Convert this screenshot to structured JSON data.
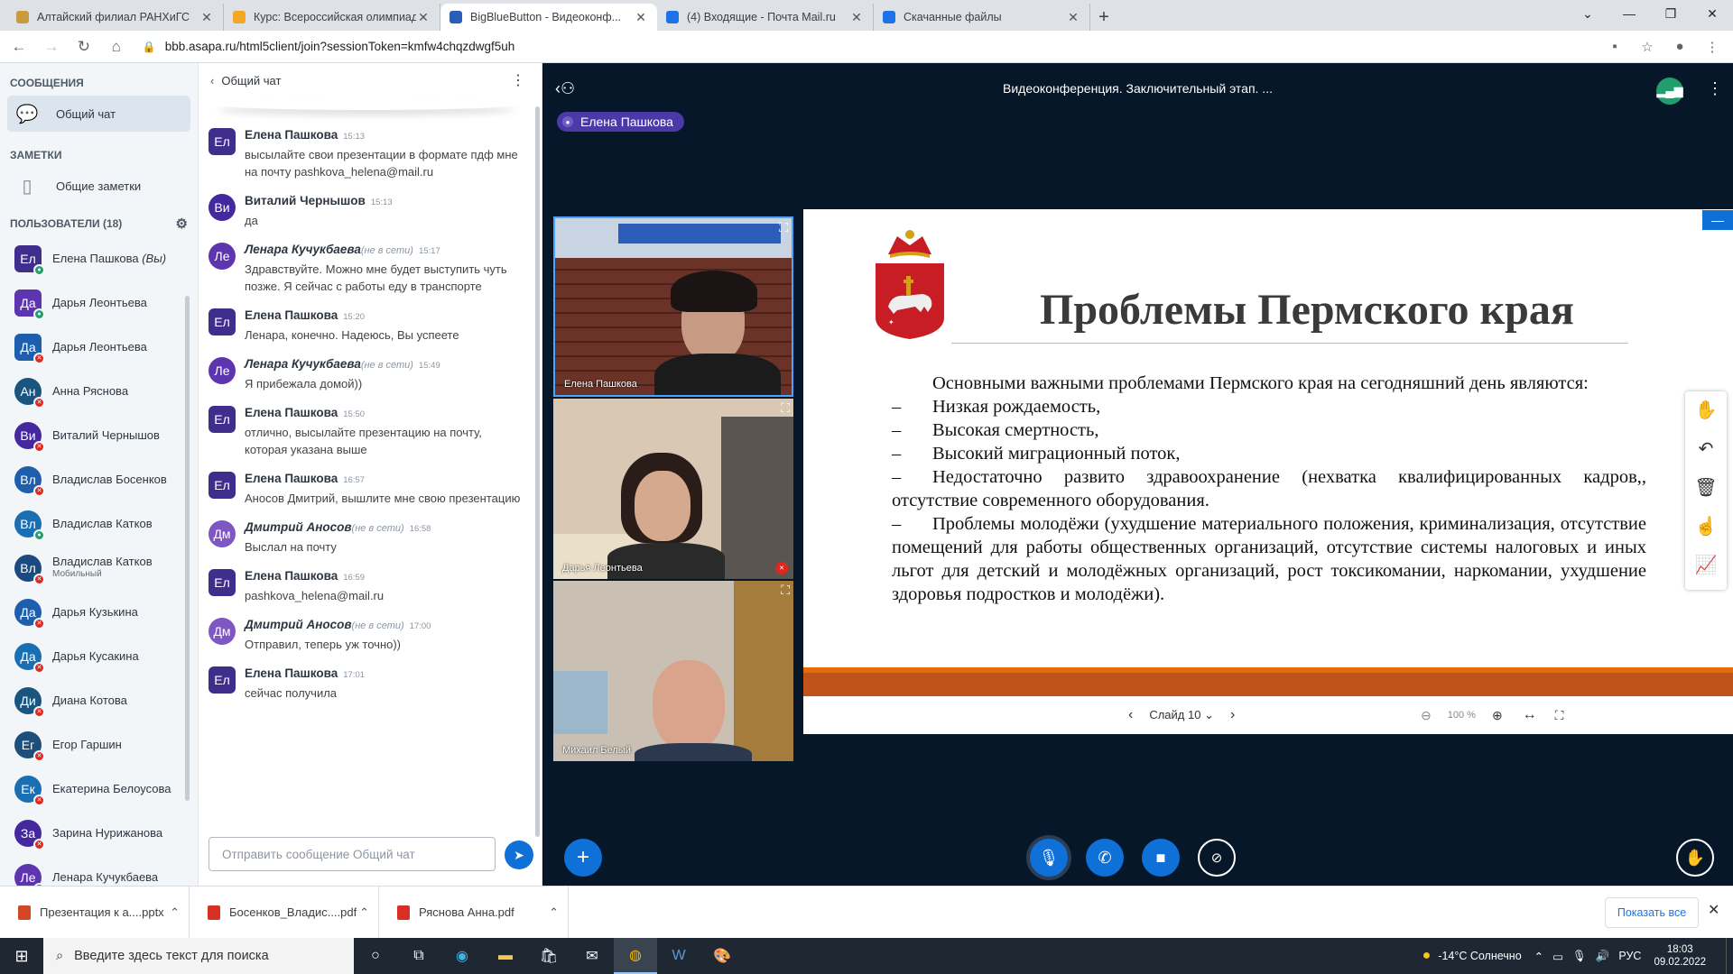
{
  "browser": {
    "tabs": [
      {
        "title": "Алтайский филиал РАНХиГС",
        "icon_color": "#c89b3c",
        "active": false
      },
      {
        "title": "Курс: Всероссийская олимпиад...",
        "icon_color": "#f5a623",
        "active": false
      },
      {
        "title": "BigBlueButton - Видеоконф...",
        "icon_color": "#2b5db7",
        "active": true
      },
      {
        "title": "(4) Входящие - Почта Mail.ru",
        "icon_color": "#1a73e8",
        "active": false
      },
      {
        "title": "Скачанные файлы",
        "icon_color": "#1a73e8",
        "active": false
      }
    ],
    "url": "bbb.asapa.ru/html5client/join?sessionToken=kmfw4chqzdwgf5uh"
  },
  "left": {
    "messages_header": "СООБЩЕНИЯ",
    "public_chat": "Общий чат",
    "notes_header": "ЗАМЕТКИ",
    "shared_notes": "Общие заметки",
    "users_header": "ПОЛЬЗОВАТЕЛИ (18)",
    "users": [
      {
        "initials": "Ел",
        "name": "Елена Пашкова",
        "suffix": "(Вы)",
        "color": "#3f2e8c",
        "shape": "square",
        "mic": "on",
        "sub": ""
      },
      {
        "initials": "Да",
        "name": "Дарья Леонтьева",
        "suffix": "",
        "color": "#5e35b1",
        "shape": "square",
        "mic": "on",
        "sub": ""
      },
      {
        "initials": "Да",
        "name": "Дарья Леонтьева",
        "suffix": "",
        "color": "#1e5fad",
        "shape": "square",
        "mic": "off",
        "sub": ""
      },
      {
        "initials": "Ан",
        "name": "Анна Ряснова",
        "suffix": "",
        "color": "#1a5580",
        "shape": "round",
        "mic": "off",
        "sub": ""
      },
      {
        "initials": "Ви",
        "name": "Виталий Чернышов",
        "suffix": "",
        "color": "#4527a0",
        "shape": "round",
        "mic": "off",
        "sub": ""
      },
      {
        "initials": "Вл",
        "name": "Владислав Босенков",
        "suffix": "",
        "color": "#1e5fad",
        "shape": "round",
        "mic": "off",
        "sub": ""
      },
      {
        "initials": "Вл",
        "name": "Владислав Катков",
        "suffix": "",
        "color": "#1a6fb3",
        "shape": "round",
        "mic": "on",
        "sub": ""
      },
      {
        "initials": "Вл",
        "name": "Владислав Катков",
        "suffix": "",
        "color": "#1a4a80",
        "shape": "round",
        "mic": "off",
        "sub": "Мобильный"
      },
      {
        "initials": "Да",
        "name": "Дарья Кузькина",
        "suffix": "",
        "color": "#1e5fad",
        "shape": "round",
        "mic": "off",
        "sub": ""
      },
      {
        "initials": "Да",
        "name": "Дарья Кусакина",
        "suffix": "",
        "color": "#1a6fb3",
        "shape": "round",
        "mic": "off",
        "sub": ""
      },
      {
        "initials": "Ди",
        "name": "Диана Котова",
        "suffix": "",
        "color": "#1a5580",
        "shape": "round",
        "mic": "off",
        "sub": ""
      },
      {
        "initials": "Ег",
        "name": "Егор Гаршин",
        "suffix": "",
        "color": "#1e4f7a",
        "shape": "round",
        "mic": "off",
        "sub": ""
      },
      {
        "initials": "Ек",
        "name": "Екатерина Белоусова",
        "suffix": "",
        "color": "#1a6fb3",
        "shape": "round",
        "mic": "off",
        "sub": ""
      },
      {
        "initials": "За",
        "name": "Зарина Нурижанова",
        "suffix": "",
        "color": "#4527a0",
        "shape": "round",
        "mic": "off",
        "sub": ""
      },
      {
        "initials": "Ле",
        "name": "Ленара Кучукбаева",
        "suffix": "",
        "color": "#5e35b1",
        "shape": "round",
        "mic": "off",
        "sub": ""
      }
    ]
  },
  "chat": {
    "title": "Общий чат",
    "offline_label": "(не в сети)",
    "messages": [
      {
        "initials": "Ел",
        "author": "Елена Пашкова",
        "time": "15:13",
        "offline": false,
        "color": "#3f2e8c",
        "shape": "square",
        "text": "высылайте свои презентации в формате пдф мне на почту pashkova_helena@mail.ru"
      },
      {
        "initials": "Ви",
        "author": "Виталий Чернышов",
        "time": "15:13",
        "offline": false,
        "color": "#4527a0",
        "shape": "round",
        "text": "да"
      },
      {
        "initials": "Ле",
        "author": "Ленара Кучукбаева",
        "time": "15:17",
        "offline": true,
        "color": "#5e35b1",
        "shape": "round",
        "text": "Здравствуйте. Можно мне будет выступить чуть позже. Я сейчас с работы еду в транспорте"
      },
      {
        "initials": "Ел",
        "author": "Елена Пашкова",
        "time": "15:20",
        "offline": false,
        "color": "#3f2e8c",
        "shape": "square",
        "text": "Ленара, конечно. Надеюсь, Вы успеете"
      },
      {
        "initials": "Ле",
        "author": "Ленара Кучукбаева",
        "time": "15:49",
        "offline": true,
        "color": "#5e35b1",
        "shape": "round",
        "text": "Я прибежала домой))"
      },
      {
        "initials": "Ел",
        "author": "Елена Пашкова",
        "time": "15:50",
        "offline": false,
        "color": "#3f2e8c",
        "shape": "square",
        "text": "отлично, высылайте презентацию на почту, которая указана выше"
      },
      {
        "initials": "Ел",
        "author": "Елена Пашкова",
        "time": "16:57",
        "offline": false,
        "color": "#3f2e8c",
        "shape": "square",
        "text": "Аносов Дмитрий, вышлите мне свою презентацию"
      },
      {
        "initials": "Дм",
        "author": "Дмитрий Аносов",
        "time": "16:58",
        "offline": true,
        "color": "#7e57c2",
        "shape": "round",
        "text": "Выслал на почту"
      },
      {
        "initials": "Ел",
        "author": "Елена Пашкова",
        "time": "16:59",
        "offline": false,
        "color": "#3f2e8c",
        "shape": "square",
        "text": "pashkova_helena@mail.ru"
      },
      {
        "initials": "Дм",
        "author": "Дмитрий Аносов",
        "time": "17:00",
        "offline": true,
        "color": "#7e57c2",
        "shape": "round",
        "text": "Отправил, теперь уж точно))"
      },
      {
        "initials": "Ел",
        "author": "Елена Пашкова",
        "time": "17:01",
        "offline": false,
        "color": "#3f2e8c",
        "shape": "square",
        "text": "сейчас получила"
      }
    ],
    "input_placeholder": "Отправить сообщение Общий чат"
  },
  "meeting": {
    "title": "Видеоконференция. Заключительный этап. ...",
    "talking": "Елена Пашкова",
    "cams": [
      {
        "name": "Елена Пашкова",
        "muted": false
      },
      {
        "name": "Дарья Леонтьева",
        "muted": true
      },
      {
        "name": "Михаил Белый",
        "muted": false
      }
    ]
  },
  "slide": {
    "title": "Проблемы Пермского края",
    "intro": "Основными важными проблемами Пермского края на сегодняшний день являются:",
    "items": [
      "Низкая рождаемость,",
      "Высокая смертность,",
      "Высокий миграционный поток,",
      "Недостаточно развито здравоохранение (нехватка квалифицированных кадров,, отсутствие современного оборудования.",
      "Проблемы молодёжи (ухудшение материального положения, криминализация, отсутствие помещений для работы общественных организаций, отсутствие системы налоговых и иных льгот для детский и молодёжных организаций, рост токсикомании, наркомании, ухудшение здоровья подростков и молодёжи)."
    ],
    "dash": "–",
    "slide_label": "Слайд 10",
    "zoom": "100 %"
  },
  "downloads": {
    "items": [
      {
        "name": "Презентация к а....pptx",
        "color": "#d24726"
      },
      {
        "name": "Босенков_Владис....pdf",
        "color": "#d93025"
      },
      {
        "name": "Ряснова Анна.pdf",
        "color": "#d93025"
      }
    ],
    "show_all": "Показать все"
  },
  "taskbar": {
    "search_placeholder": "Введите здесь текст для поиска",
    "weather": "-14°C Солнечно",
    "lang": "РУС",
    "time": "18:03",
    "date": "09.02.2022"
  }
}
